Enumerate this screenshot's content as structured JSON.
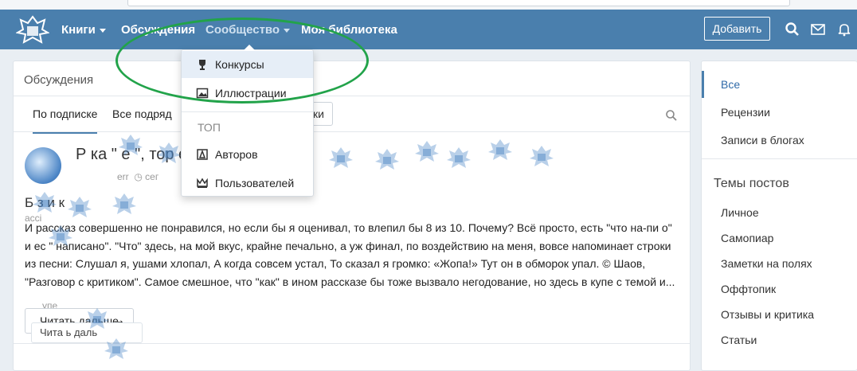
{
  "nav": {
    "books": "Книги",
    "discussions": "Обсуждения",
    "community": "Сообщество",
    "my_library": "Моя библиотека",
    "add": "Добавить"
  },
  "dropdown": {
    "items": [
      "Конкурсы",
      "Иллюстрации"
    ],
    "top_heading": "ТОП",
    "top_items": [
      "Авторов",
      "Пользователей"
    ]
  },
  "main": {
    "title": "Обсуждения",
    "tabs": [
      "По подписке",
      "Все подряд"
    ],
    "ghost_btn": "ки",
    "post": {
      "title_visible": "Р   ка     \"         е   \",  тор            ел",
      "meta_user": "err",
      "meta_time": "сег",
      "heading": "Б   з  и к",
      "subline": "ассі",
      "text": "И   рассказ совершенно не понравился, но если бы я оценивал, то влепил бы 8 из 10. Почему? Всё просто, есть \"что на-пи   о\" и ес   \"   написано\". \"Что\" здесь, на мой вкус, крайне печально, а уж финал, по воздействию на меня, вовсе напоминает строки из песни: Слушал я, ушами хлопал, А когда совсем устал, То сказал я громко: «Жопа!» Тут он в обморок упал. © Шаов, \"Разговор с критиком\". Самое смешное, что \"как\" в ином рассказе бы тоже вызвало негодование, но здесь в купе с темой и...",
      "upe": "упе",
      "read_more": "Читать дальше",
      "read_more_arrow": "→",
      "read_more2": "Чита    ь даль"
    }
  },
  "sidebar": {
    "filters": [
      "Все",
      "Рецензии",
      "Записи в блогах"
    ],
    "topics_title": "Темы постов",
    "topics": [
      "Личное",
      "Самопиар",
      "Заметки на полях",
      "Оффтопик",
      "Отзывы и критика",
      "Статьи"
    ]
  },
  "colors": {
    "nav_bg": "#4a7fad",
    "accent": "#2f6aa8",
    "annotation": "#22a34a"
  }
}
